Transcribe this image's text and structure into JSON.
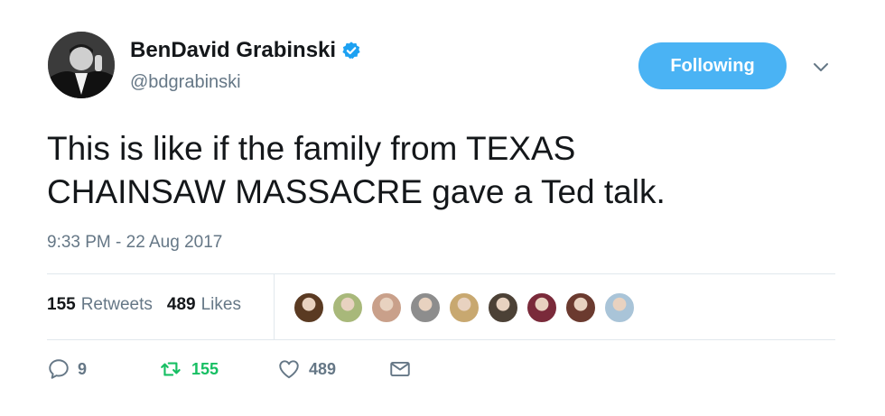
{
  "author": {
    "name": "BenDavid Grabinski",
    "handle": "@bdgrabinski",
    "verified": true,
    "avatar_icon": "profile-photo"
  },
  "follow_button": {
    "label": "Following",
    "color": "#4ab3f4"
  },
  "menu_icon": "chevron-down-icon",
  "tweet": {
    "text_line1": "This is like if the family from TEXAS",
    "text_line2": "CHAINSAW MASSACRE gave a Ted talk.",
    "timestamp": "9:33 PM - 22 Aug 2017"
  },
  "stats": {
    "retweets_count": "155",
    "retweets_label": "Retweets",
    "likes_count": "489",
    "likes_label": "Likes"
  },
  "likers": [
    {
      "color": "#5a3a22"
    },
    {
      "color": "#a8b87a"
    },
    {
      "color": "#c9a08a"
    },
    {
      "color": "#8d8d8d"
    },
    {
      "color": "#c8a870"
    },
    {
      "color": "#4c4136"
    },
    {
      "color": "#7a2a3a"
    },
    {
      "color": "#6b3a2f"
    },
    {
      "color": "#a9c4d8"
    }
  ],
  "actions": {
    "reply_count": "9",
    "retweet_count": "155",
    "like_count": "489"
  },
  "colors": {
    "text": "#14171a",
    "secondary": "#657786",
    "accent": "#1da1f2",
    "retweet_green": "#17bf63",
    "divider": "#e1e8ed"
  }
}
